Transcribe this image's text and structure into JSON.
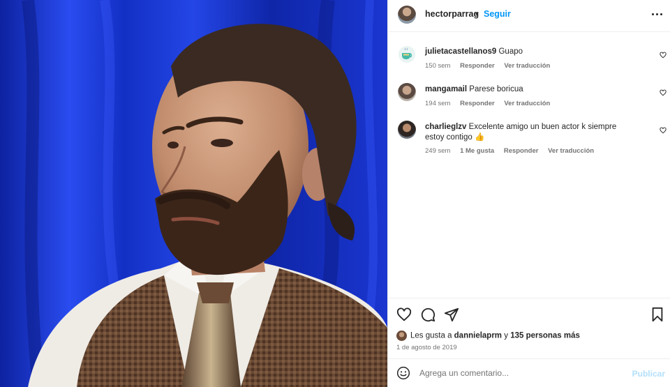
{
  "media": {
    "alt_subject": "photo",
    "colors": {
      "backdrop": "#1228b8",
      "hair": "#3a2a22",
      "skin": "#c9977a",
      "vest": "#6a4a34",
      "shirt": "#f2f0ec"
    }
  },
  "header": {
    "owner_username": "hectorparrag",
    "separator": "•",
    "follow_label": "Seguir"
  },
  "comments": [
    {
      "username": "julietacastellanos9",
      "text": "Guapo",
      "age": "150 sem",
      "likes": "",
      "reply_label": "Responder",
      "translate_label": "Ver traducción",
      "avatar_icon": "teacup-avatar-icon"
    },
    {
      "username": "mangamail",
      "text": "Parese boricua",
      "age": "194 sem",
      "likes": "",
      "reply_label": "Responder",
      "translate_label": "Ver traducción",
      "avatar_icon": "person-avatar-icon"
    },
    {
      "username": "charlieglzv",
      "text": "Excelente amigo un buen actor k siempre estoy contigo",
      "emoji": "👍",
      "age": "249 sem",
      "likes": "1 Me gusta",
      "reply_label": "Responder",
      "translate_label": "Ver traducción",
      "avatar_icon": "person-avatar-icon"
    }
  ],
  "actions": {
    "like_icon": "heart-icon",
    "comment_icon": "comment-bubble-icon",
    "share_icon": "paper-plane-icon",
    "save_icon": "bookmark-icon"
  },
  "likes_summary": {
    "prefix": "Les gusta a ",
    "user": "dannielaprm",
    "connector": " y ",
    "others": "135 personas más"
  },
  "date": "1 de agosto de 2019",
  "add_comment": {
    "placeholder": "Agrega un comentario...",
    "publish_label": "Publicar"
  },
  "colors": {
    "accent": "#0095f6",
    "publish_disabled": "#b2dffc",
    "text": "#262626",
    "muted": "#737373"
  }
}
